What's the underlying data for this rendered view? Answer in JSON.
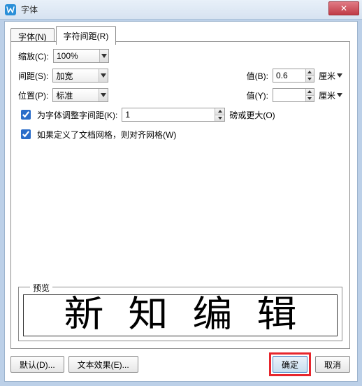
{
  "window": {
    "title": "字体",
    "close_glyph": "✕"
  },
  "tabs": {
    "font": "字体(N)",
    "spacing": "字符间距(R)"
  },
  "scale": {
    "label": "缩放(C):",
    "value": "100%"
  },
  "spacing": {
    "label": "间距(S):",
    "value": "加宽"
  },
  "position": {
    "label": "位置(P):",
    "value": "标准"
  },
  "b_value": {
    "label": "值(B):",
    "value": "0.6",
    "unit": "厘米"
  },
  "y_value": {
    "label": "值(Y):",
    "value": "",
    "unit": "厘米"
  },
  "kerning": {
    "label": "为字体调整字间距(K):",
    "value": "1",
    "unit": "磅或更大(O)"
  },
  "snapgrid": {
    "label": "如果定义了文档网格，则对齐网格(W)"
  },
  "preview": {
    "label": "预览",
    "c1": "新",
    "c2": "知",
    "c3": "编",
    "c4": "辑"
  },
  "buttons": {
    "defaults": "默认(D)...",
    "texteffects": "文本效果(E)...",
    "ok": "确定",
    "cancel": "取消"
  }
}
